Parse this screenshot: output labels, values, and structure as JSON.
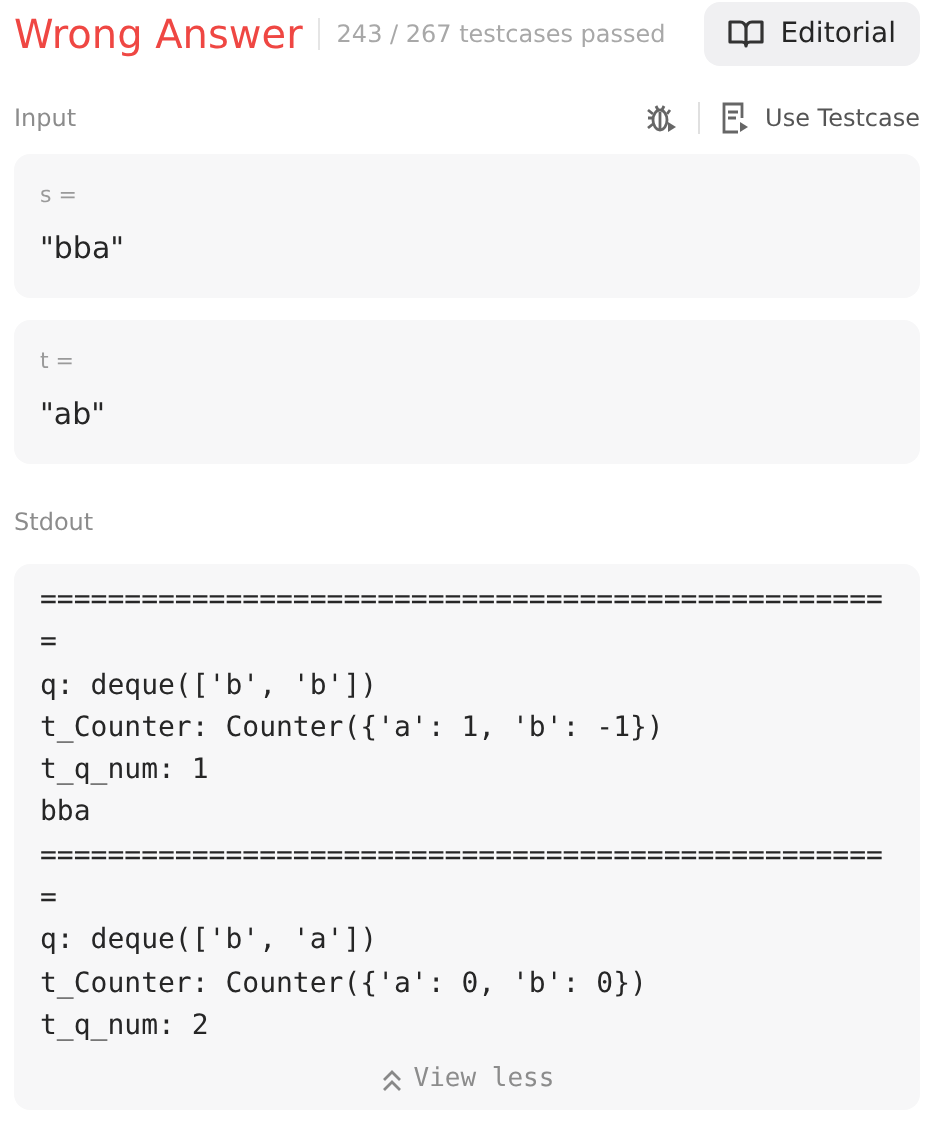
{
  "header": {
    "verdict": "Wrong Answer",
    "summary": "243 / 267 testcases passed",
    "editorial_button": "Editorial"
  },
  "input": {
    "label": "Input",
    "use_testcase": "Use Testcase",
    "params": [
      {
        "name": "s =",
        "value": "\"bba\""
      },
      {
        "name": "t =",
        "value": "\"ab\""
      }
    ]
  },
  "stdout": {
    "label": "Stdout",
    "lines": [
      "==================================================",
      "=",
      "q: deque(['b', 'b'])",
      "t_Counter: Counter({'a': 1, 'b': -1})",
      "t_q_num: 1",
      "bba",
      "==================================================",
      "=",
      "q: deque(['b', 'a'])",
      "t_Counter: Counter({'a': 0, 'b': 0})",
      "t_q_num: 2"
    ],
    "toggle": "View less"
  }
}
